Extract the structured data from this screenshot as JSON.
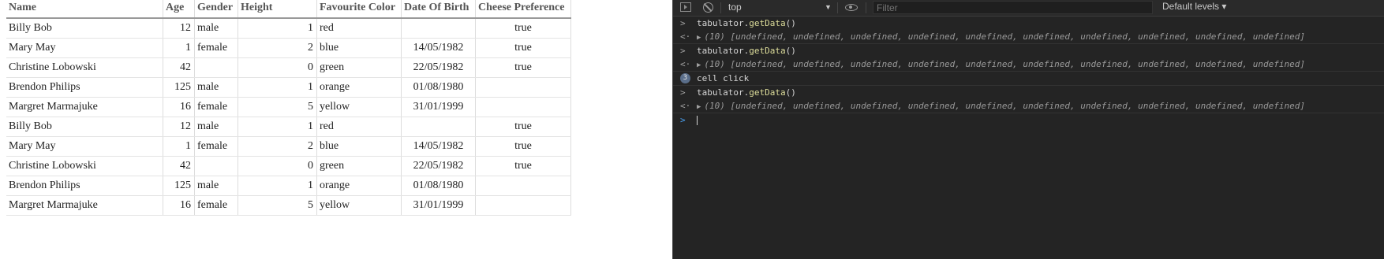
{
  "table": {
    "columns": [
      "Name",
      "Age",
      "Gender",
      "Height",
      "Favourite Color",
      "Date Of Birth",
      "Cheese Preference"
    ],
    "rows": [
      [
        "Billy Bob",
        "12",
        "male",
        "1",
        "red",
        "",
        "true"
      ],
      [
        "Mary May",
        "1",
        "female",
        "2",
        "blue",
        "14/05/1982",
        "true"
      ],
      [
        "Christine Lobowski",
        "42",
        "",
        "0",
        "green",
        "22/05/1982",
        "true"
      ],
      [
        "Brendon Philips",
        "125",
        "male",
        "1",
        "orange",
        "01/08/1980",
        ""
      ],
      [
        "Margret Marmajuke",
        "16",
        "female",
        "5",
        "yellow",
        "31/01/1999",
        ""
      ],
      [
        "Billy Bob",
        "12",
        "male",
        "1",
        "red",
        "",
        "true"
      ],
      [
        "Mary May",
        "1",
        "female",
        "2",
        "blue",
        "14/05/1982",
        "true"
      ],
      [
        "Christine Lobowski",
        "42",
        "",
        "0",
        "green",
        "22/05/1982",
        "true"
      ],
      [
        "Brendon Philips",
        "125",
        "male",
        "1",
        "orange",
        "01/08/1980",
        ""
      ],
      [
        "Margret Marmajuke",
        "16",
        "female",
        "5",
        "yellow",
        "31/01/1999",
        ""
      ]
    ]
  },
  "devtools": {
    "context": "top",
    "filter_placeholder": "Filter",
    "levels": "Default levels ▾",
    "lines": [
      {
        "kind": "input",
        "obj": "tabulator.",
        "method": "getData",
        "rest": "()"
      },
      {
        "kind": "output",
        "text": "(10) [undefined, undefined, undefined, undefined, undefined, undefined, undefined, undefined, undefined, undefined]"
      },
      {
        "kind": "input",
        "obj": "tabulator.",
        "method": "getData",
        "rest": "()"
      },
      {
        "kind": "output",
        "text": "(10) [undefined, undefined, undefined, undefined, undefined, undefined, undefined, undefined, undefined, undefined]"
      },
      {
        "kind": "log",
        "count": "3",
        "text": "cell click"
      },
      {
        "kind": "input",
        "obj": "tabulator.",
        "method": "getData",
        "rest": "()"
      },
      {
        "kind": "output",
        "text": "(10) [undefined, undefined, undefined, undefined, undefined, undefined, undefined, undefined, undefined, undefined]"
      },
      {
        "kind": "prompt"
      }
    ]
  }
}
